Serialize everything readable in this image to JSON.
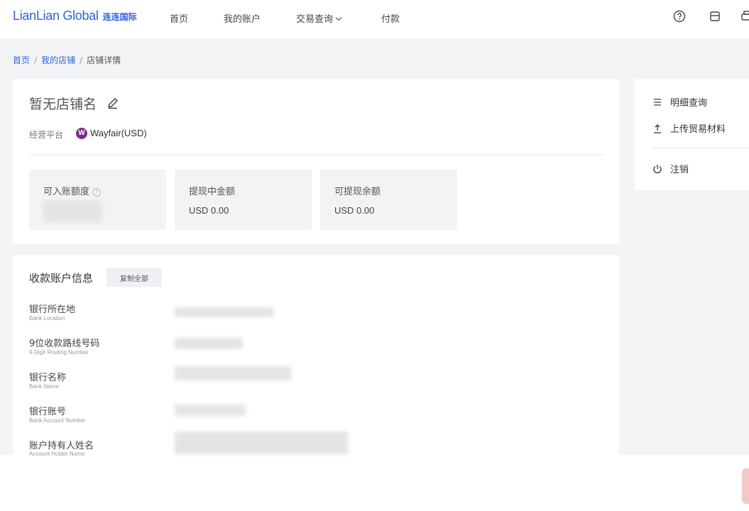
{
  "header": {
    "logo_en": "LianLian Global",
    "logo_cn": "连连国际",
    "nav": [
      {
        "label": "首页"
      },
      {
        "label": "我的账户"
      },
      {
        "label": "交易查询"
      },
      {
        "label": "付款"
      }
    ],
    "icons": [
      "help-circle-icon",
      "calendar-icon",
      "print-icon"
    ]
  },
  "breadcrumb": {
    "items": [
      "首页",
      "我的店铺",
      "店铺详情"
    ],
    "separator": "/"
  },
  "store": {
    "name": "暂无店铺名",
    "platform_label": "经营平台",
    "platform_badge": "W",
    "platform_value": "Wayfair(USD)",
    "platform_color": "#7b2d8b"
  },
  "stats": [
    {
      "label": "可入账额度",
      "value": ""
    },
    {
      "label": "提现中金额",
      "value": "USD 0.00"
    },
    {
      "label": "可提现余额",
      "value": "USD 0.00"
    }
  ],
  "account_info": {
    "title": "收款账户信息",
    "copy_all_label": "复制全部",
    "fields": [
      {
        "label": "银行所在地",
        "sub": "Bank Location"
      },
      {
        "label": "9位收款路线号码",
        "sub": "9-Digit Routing Number"
      },
      {
        "label": "银行名称",
        "sub": "Bank Name"
      },
      {
        "label": "银行账号",
        "sub": "Bank Account Number"
      },
      {
        "label": "账户持有人姓名",
        "sub": "Account Holder Name"
      }
    ]
  },
  "sidebar": {
    "items": [
      {
        "label": "明细查询",
        "icon": "list-icon"
      },
      {
        "label": "上传贸易材料",
        "icon": "upload-icon"
      },
      {
        "label": "注销",
        "icon": "power-icon"
      }
    ]
  },
  "colors": {
    "brand": "#2f62d8",
    "page_bg": "#f3f4f6",
    "stat_bg": "#f2f3f5"
  }
}
